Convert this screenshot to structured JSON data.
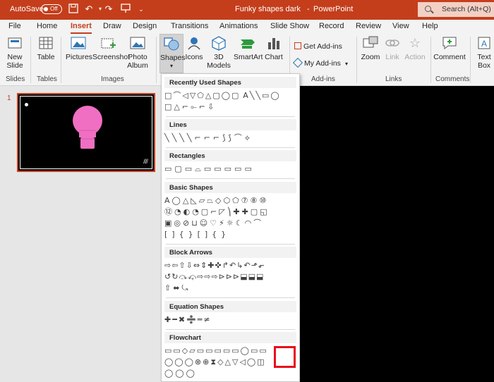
{
  "titlebar": {
    "autosave_label": "AutoSave",
    "autosave_state": "Off",
    "document_title": "Funky shapes dark",
    "separator": "-",
    "app_name": "PowerPoint",
    "search_placeholder": "Search (Alt+Q)"
  },
  "tabs": [
    "File",
    "Home",
    "Insert",
    "Draw",
    "Design",
    "Transitions",
    "Animations",
    "Slide Show",
    "Record",
    "Review",
    "View",
    "Help"
  ],
  "active_tab": "Insert",
  "ribbon": {
    "new_slide": "New\nSlide",
    "table": "Table",
    "pictures": "Pictures",
    "screenshot": "Screenshot",
    "photo_album": "Photo\nAlbum",
    "shapes": "Shapes",
    "icons": "Icons",
    "models": "3D\nModels",
    "smartart": "SmartArt",
    "chart": "Chart",
    "get_addins": "Get Add-ins",
    "my_addins": "My Add-ins",
    "zoom": "Zoom",
    "link": "Link",
    "action": "Action",
    "comment": "Comment",
    "textbox": "Text\nBox",
    "groups": {
      "slides": "Slides",
      "tables": "Tables",
      "images": "Images",
      "addins": "Add-ins",
      "links": "Links",
      "comments": "Comments"
    }
  },
  "slide_panel": {
    "slide_number": "1"
  },
  "shapes_menu": {
    "sections": {
      "recent": "Recently Used Shapes",
      "lines": "Lines",
      "rectangles": "Rectangles",
      "basic": "Basic Shapes",
      "block_arrows": "Block Arrows",
      "equation": "Equation Shapes",
      "flowchart": "Flowchart"
    },
    "rows": {
      "recent1": "□⌒◁▽⬠△▢◯▢ A╲╲▭◯",
      "recent2": "□△⌐⟜⌐⇩",
      "lines1": "╲╲╲╲⌐⌐⌐⟆⟆⌒⟡",
      "rect1": "▭▢▭⌓▭▭▭▭▭",
      "basic1": "A◯△◺▱⏢◇⬡⬠⑦⑧⑩",
      "basic2": "⑫◔◐◔▢⌐◸⎞✚✚▢◱",
      "basic3": "▣◎⊘⊔☺♡⚡☼☾◠⌒",
      "basic4": "[]{}[]{}",
      "arrows1": "⇨⇦⇧⇩⇔⇕✚✜↱↶↳↶⬏⬐",
      "arrows2": "↺↻⤼⤽⇨⇨⇨⊳⊳⊳⬓⬓⬓",
      "arrows3": "⇧⬌⤿",
      "equation1": "✚━✖➗═≠",
      "flow1": "▭▭◇▱▭▭▭▭▭◯▭▭",
      "flow2": "◯◯◯⊗⊕⧗◇△▽◁◯◫",
      "flow3": "◯◯◯"
    }
  },
  "colors": {
    "brand": "#c43e1c",
    "highlight": "#e8101a",
    "bulb": "#f06fc2"
  }
}
